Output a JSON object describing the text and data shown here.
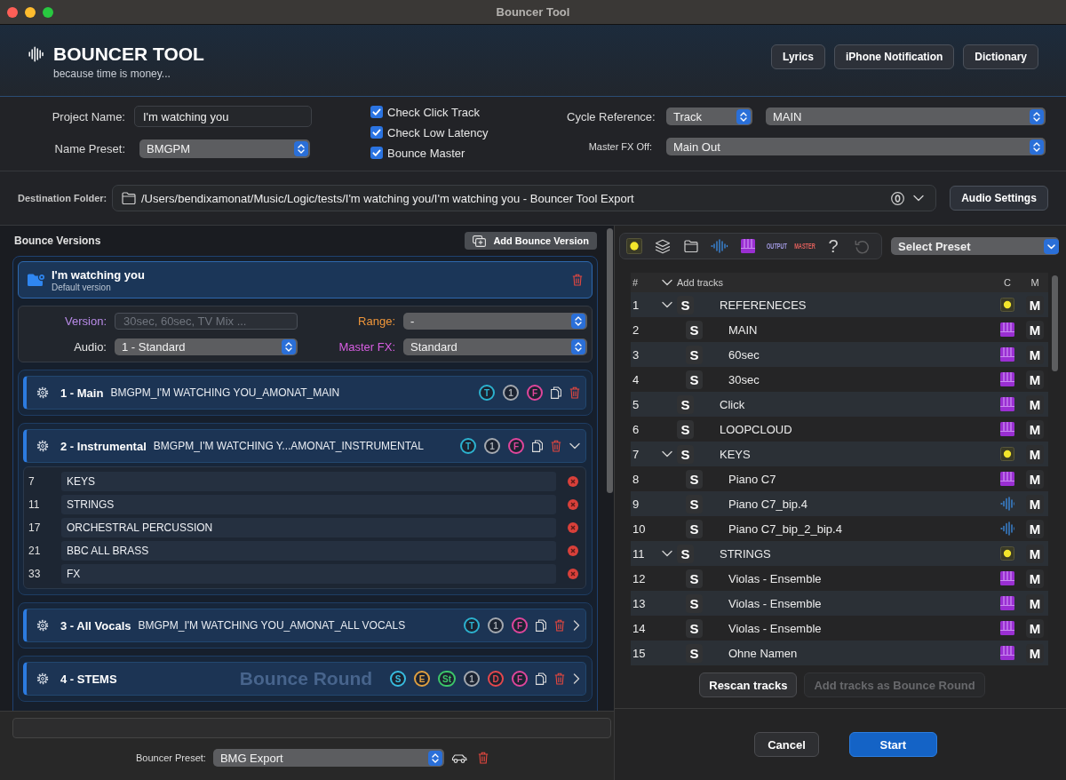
{
  "window": {
    "title": "Bouncer Tool"
  },
  "header": {
    "title": "BOUNCER TOOL",
    "subtitle": "because time is money...",
    "buttons": [
      "Lyrics",
      "iPhone Notification",
      "Dictionary"
    ]
  },
  "settings": {
    "project_name": {
      "label": "Project Name:",
      "value": "I'm watching you"
    },
    "name_preset": {
      "label": "Name Preset:",
      "value": "BMGPM"
    },
    "checks": [
      {
        "label": "Check Click Track",
        "checked": true
      },
      {
        "label": "Check Low Latency",
        "checked": true
      },
      {
        "label": "Bounce Master",
        "checked": true
      }
    ],
    "cycle_reference": {
      "label": "Cycle Reference:",
      "mode": "Track",
      "value": "MAIN"
    },
    "master_fx_off": {
      "label": "Master FX Off:",
      "value": "Main Out"
    }
  },
  "destination": {
    "label": "Destination Folder:",
    "path": "/Users/bendixamonat/Music/Logic/tests/I'm watching you/I'm watching you - Bouncer Tool Export",
    "button": "Audio Settings"
  },
  "bounce_versions": {
    "title": "Bounce Versions",
    "add_button": "Add Bounce Version",
    "version": {
      "name": "I'm watching you",
      "subtitle": "Default version",
      "fields": [
        {
          "label": "Version:",
          "kind": "input",
          "placeholder": "30sec, 60sec, TV Mix ...",
          "color": "#b98be8"
        },
        {
          "label": "Range:",
          "kind": "select",
          "value": "-",
          "color": "#f0963a"
        },
        {
          "label": "Audio:",
          "kind": "select",
          "value": "1 - Standard",
          "color": "#e4e4e4"
        },
        {
          "label": "Master FX:",
          "kind": "select",
          "value": "Standard",
          "color": "#d85ee2"
        }
      ]
    },
    "rounds": [
      {
        "title": "1 - Main",
        "filename": "BMGPM_I'M WATCHING YOU_AMONAT_MAIN",
        "badges": [
          {
            "label": "T",
            "color": "#2cb2cf"
          },
          {
            "label": "1",
            "color": "#a4a9b0"
          },
          {
            "label": "F",
            "color": "#e0469c"
          }
        ]
      },
      {
        "title": "2 - Instrumental",
        "filename": "BMGPM_I'M WATCHING Y...AMONAT_INSTRUMENTAL",
        "badges": [
          {
            "label": "T",
            "color": "#2cb2cf"
          },
          {
            "label": "1",
            "color": "#a4a9b0"
          },
          {
            "label": "F",
            "color": "#e0469c"
          }
        ],
        "expanded": true,
        "tracks": [
          {
            "number": "7",
            "name": "KEYS"
          },
          {
            "number": "11",
            "name": "STRINGS"
          },
          {
            "number": "17",
            "name": "ORCHESTRAL PERCUSSION"
          },
          {
            "number": "21",
            "name": "BBC ALL BRASS"
          },
          {
            "number": "33",
            "name": "FX"
          }
        ]
      },
      {
        "title": "3 - All Vocals",
        "filename": "BMGPM_I'M WATCHING YOU_AMONAT_ALL VOCALS",
        "badges": [
          {
            "label": "T",
            "color": "#2cb2cf"
          },
          {
            "label": "1",
            "color": "#a4a9b0"
          },
          {
            "label": "F",
            "color": "#e0469c"
          }
        ],
        "expanded": false
      },
      {
        "title": "4 - STEMS",
        "background_label": "Bounce Round",
        "badges": [
          {
            "label": "S",
            "color": "#38bde0"
          },
          {
            "label": "E",
            "color": "#e0a040"
          },
          {
            "label": "St",
            "color": "#3cc76a"
          },
          {
            "label": "1",
            "color": "#a4a9b0"
          },
          {
            "label": "D",
            "color": "#e5484d"
          },
          {
            "label": "F",
            "color": "#e0469c"
          }
        ],
        "expanded": false
      }
    ]
  },
  "bouncer_preset": {
    "label": "Bouncer Preset:",
    "value": "BMG Export"
  },
  "tracks_panel": {
    "toolbar": [
      {
        "kind": "dot"
      },
      {
        "kind": "layers"
      },
      {
        "kind": "folder"
      },
      {
        "kind": "waveform"
      },
      {
        "kind": "piano"
      },
      {
        "kind": "label",
        "label": "OUTPUT",
        "color": "#a29ae2"
      },
      {
        "kind": "label",
        "label": "MASTER",
        "color": "#e2605c"
      },
      {
        "kind": "glyph",
        "label": "?"
      },
      {
        "kind": "undo"
      }
    ],
    "preset_select": "Select Preset",
    "columns": [
      "#",
      "Add tracks",
      "C",
      "M"
    ],
    "tracks": [
      {
        "number": "1",
        "name": "REFERENECES",
        "kind": "folder",
        "expanded": true,
        "solo": "S",
        "mute": "M",
        "children": [
          {
            "number": "2",
            "name": "MAIN",
            "kind": "midi",
            "solo": "S",
            "mute": "M"
          },
          {
            "number": "3",
            "name": "60sec",
            "kind": "midi",
            "solo": "S",
            "mute": "M"
          },
          {
            "number": "4",
            "name": "30sec",
            "kind": "midi",
            "solo": "S",
            "mute": "M"
          }
        ]
      },
      {
        "number": "5",
        "name": "Click",
        "kind": "midi",
        "solo": "S",
        "mute": "M"
      },
      {
        "number": "6",
        "name": "LOOPCLOUD",
        "kind": "midi",
        "solo": "S",
        "mute": "M"
      },
      {
        "number": "7",
        "name": "KEYS",
        "kind": "folder",
        "expanded": true,
        "solo": "S",
        "mute": "M",
        "children": [
          {
            "number": "8",
            "name": "Piano C7",
            "kind": "midi",
            "solo": "S",
            "mute": "M"
          },
          {
            "number": "9",
            "name": "Piano C7_bip.4",
            "kind": "audio",
            "solo": "S",
            "mute": "M"
          },
          {
            "number": "10",
            "name": "Piano C7_bip_2_bip.4",
            "kind": "audio",
            "solo": "S",
            "mute": "M"
          }
        ]
      },
      {
        "number": "11",
        "name": "STRINGS",
        "kind": "folder",
        "expanded": true,
        "solo": "S",
        "mute": "M",
        "children": [
          {
            "number": "12",
            "name": "Violas - Ensemble",
            "kind": "midi",
            "solo": "S",
            "mute": "M"
          },
          {
            "number": "13",
            "name": "Violas - Ensemble",
            "kind": "midi",
            "solo": "S",
            "mute": "M"
          },
          {
            "number": "14",
            "name": "Violas - Ensemble",
            "kind": "midi",
            "solo": "S",
            "mute": "M"
          },
          {
            "number": "15",
            "name": "Ohne Namen",
            "kind": "midi",
            "solo": "S",
            "mute": "M"
          }
        ]
      }
    ],
    "buttons": [
      {
        "label": "Rescan tracks",
        "disabled": false
      },
      {
        "label": "Add tracks as Bounce Round",
        "disabled": true
      }
    ]
  },
  "footer_buttons": [
    {
      "label": "Cancel",
      "kind": "secondary"
    },
    {
      "label": "Start",
      "kind": "primary"
    }
  ]
}
